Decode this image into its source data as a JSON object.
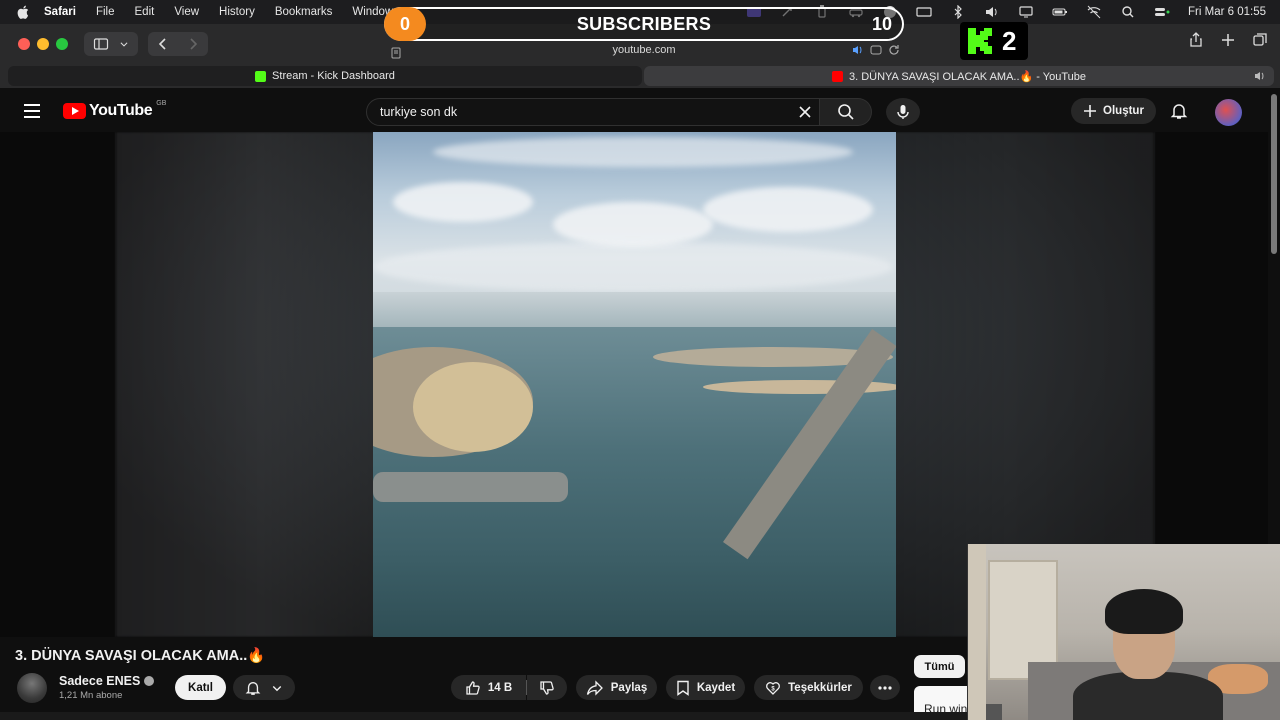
{
  "menubar": {
    "app": "Safari",
    "items": [
      "File",
      "Edit",
      "View",
      "History",
      "Bookmarks",
      "Window"
    ],
    "clock": "Fri Mar 6  01:55"
  },
  "overlay": {
    "current": "0",
    "label": "SUBSCRIBERS",
    "goal": "10",
    "kick_count": "2"
  },
  "browser": {
    "url": "youtube.com",
    "tabs": [
      {
        "label": "Stream - Kick Dashboard",
        "icon": "kick-favicon"
      },
      {
        "label": "3. DÜNYA SAVAŞI OLACAK AMA..🔥 - YouTube",
        "icon": "youtube-favicon"
      }
    ]
  },
  "youtube": {
    "logo_text": "YouTube",
    "country_code": "GB",
    "search_value": "turkiye son dk",
    "create_label": "Oluştur",
    "video_title": "3. DÜNYA SAVAŞI OLACAK AMA..🔥",
    "channel_name": "Sadece ENES",
    "channel_subs": "1,21 Mn abone",
    "join_label": "Katıl",
    "like_count": "14 B",
    "share_label": "Paylaş",
    "save_label": "Kaydet",
    "thanks_label": "Teşekkürler",
    "chip_all": "Tümü",
    "ad_text": "Run win"
  },
  "colors": {
    "youtube_red": "#ff0000",
    "kick_green": "#53fc18",
    "overlay_orange": "#f48a1f"
  }
}
